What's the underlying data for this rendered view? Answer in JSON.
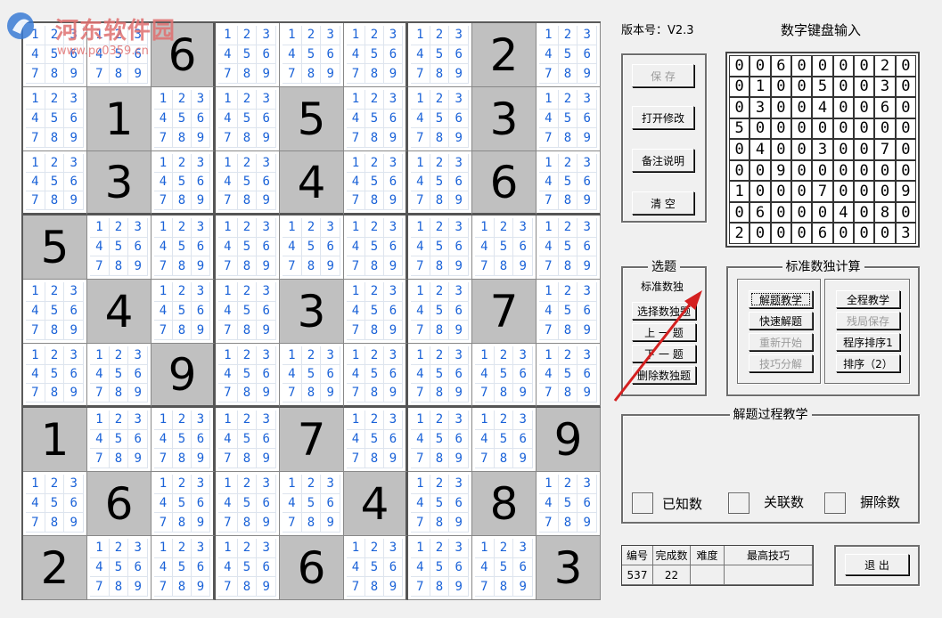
{
  "watermark": {
    "title": "河东软件园",
    "url": "www.pc0359.cn"
  },
  "version": "版本号：V2.3",
  "keypad": {
    "title": "数字键盘输入",
    "rows": [
      [
        "0",
        "0",
        "6",
        "0",
        "0",
        "0",
        "0",
        "2",
        "0"
      ],
      [
        "0",
        "1",
        "0",
        "0",
        "5",
        "0",
        "0",
        "3",
        "0"
      ],
      [
        "0",
        "3",
        "0",
        "0",
        "4",
        "0",
        "0",
        "6",
        "0"
      ],
      [
        "5",
        "0",
        "0",
        "0",
        "0",
        "0",
        "0",
        "0",
        "0"
      ],
      [
        "0",
        "4",
        "0",
        "0",
        "3",
        "0",
        "0",
        "7",
        "0"
      ],
      [
        "0",
        "0",
        "9",
        "0",
        "0",
        "0",
        "0",
        "0",
        "0"
      ],
      [
        "1",
        "0",
        "0",
        "0",
        "7",
        "0",
        "0",
        "0",
        "9"
      ],
      [
        "0",
        "6",
        "0",
        "0",
        "0",
        "4",
        "0",
        "8",
        "0"
      ],
      [
        "2",
        "0",
        "0",
        "0",
        "6",
        "0",
        "0",
        "0",
        "3"
      ]
    ]
  },
  "file_buttons": {
    "save": "保  存",
    "open_edit": "打开修改",
    "notes": "备注说明",
    "clear": "清  空"
  },
  "select_group": {
    "title": "选题",
    "subtitle": "标准数独",
    "choose": "选择数独题",
    "prev": "上  一  题",
    "next": "下  一  题",
    "delete": "删除数独题"
  },
  "calc_group": {
    "title": "标准数独计算",
    "solve_teach": "解题教学",
    "quick_solve": "快速解题",
    "restart": "重新开始",
    "technique": "技巧分解",
    "full_teach": "全程教学",
    "save_rest": "残局保存",
    "program_sort1": "程序排序1",
    "sort2": "排序（2）"
  },
  "process_group": {
    "title": "解题过程教学",
    "known": "已知数",
    "related": "关联数",
    "eliminated": "摒除数"
  },
  "info": {
    "headers": [
      "编号",
      "完成数",
      "难度",
      "最高技巧"
    ],
    "values": [
      "537",
      "22",
      "",
      ""
    ]
  },
  "exit": "退  出",
  "candidate_digits": [
    "1",
    "2",
    "3",
    "4",
    "5",
    "6",
    "7",
    "8",
    "9"
  ],
  "colors": {
    "candidate": "#1a62d8",
    "given_bg": "#c0c0c0",
    "watermark": "#e07070",
    "arrow": "#d42020"
  }
}
